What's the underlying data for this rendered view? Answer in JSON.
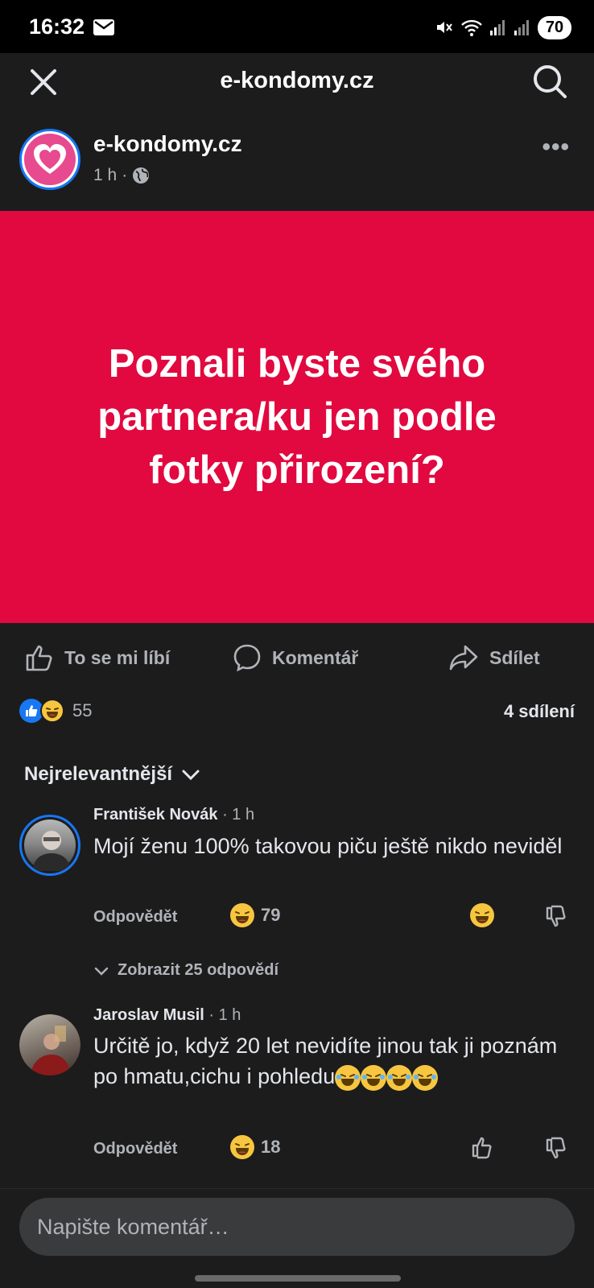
{
  "status_bar": {
    "time": "16:32",
    "battery": "70"
  },
  "top_nav": {
    "title": "e-kondomy.cz"
  },
  "post": {
    "page_name": "e-kondomy.cz",
    "time": "1 h",
    "separator": "·",
    "image_text": "Poznali byste svého partnera/ku jen podle fotky přirození?",
    "image_bg": "#e1093f"
  },
  "actions": {
    "like": "To se mi líbí",
    "comment": "Komentář",
    "share": "Sdílet"
  },
  "reactions": {
    "count": "55",
    "shares": "4 sdílení"
  },
  "sort": {
    "label": "Nejrelevantnější"
  },
  "comments": [
    {
      "author": "František Novák",
      "time": "· 1 h",
      "text": "Mojí ženu 100% takovou piču ještě nikdo neviděl",
      "reply": "Odpovědět",
      "reaction_count": "79",
      "view_replies": "Zobrazit 25 odpovědí"
    },
    {
      "author": "Jaroslav Musil",
      "time": "· 1 h",
      "text": "Určitě jo, když 20 let nevidíte jinou tak ji poznám po hmatu,cichu i pohledu",
      "reply": "Odpovědět",
      "reaction_count": "18"
    }
  ],
  "composer": {
    "placeholder": "Napište komentář…"
  },
  "colors": {
    "background": "#1c1c1d",
    "accent": "#1877f2",
    "text": "#e4e6eb",
    "muted": "#b0b3b8"
  }
}
